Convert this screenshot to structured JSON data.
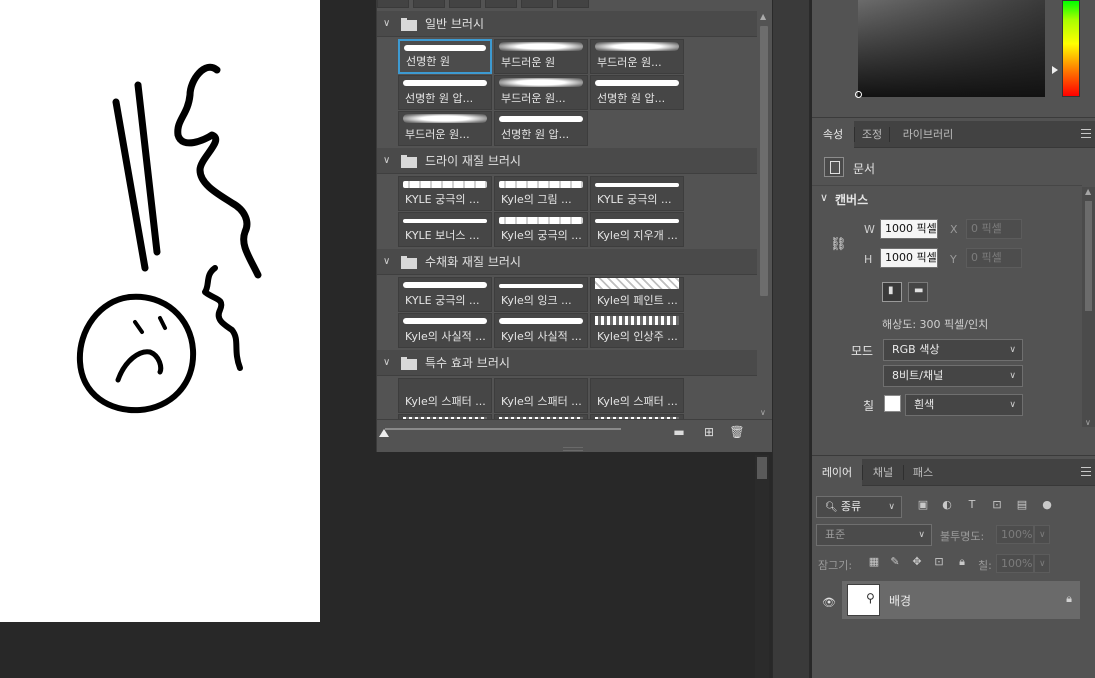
{
  "brush_panel": {
    "groups": [
      {
        "name": "일반 브러시",
        "brushes": [
          "선명한 원",
          "부드러운 원",
          "부드러운 원...",
          "선명한 원 압...",
          "부드러운 원...",
          "선명한 원 압...",
          "부드러운 원...",
          "선명한 원 압..."
        ]
      },
      {
        "name": "드라이 재질 브러시",
        "brushes": [
          "KYLE 궁극의 ...",
          "Kyle의 그림 ...",
          "KYLE 궁극의 ...",
          "KYLE 보너스 ...",
          "Kyle의 궁극의 ...",
          "Kyle의 지우개 ..."
        ]
      },
      {
        "name": "수채화 재질 브러시",
        "brushes": [
          "KYLE 궁극의 ...",
          "Kyle의 잉크 ...",
          "Kyle의 페인트 ...",
          "Kyle의 사실적 ...",
          "Kyle의 사실적 ...",
          "Kyle의 인상주 ..."
        ]
      },
      {
        "name": "특수 효과 브러시",
        "brushes": [
          "Kyle의 스패터 ...",
          "Kyle의 스패터 ...",
          "Kyle의 스패터 ..."
        ]
      }
    ],
    "selected_brush": "선명한 원",
    "footer_icons": [
      "new-group-icon",
      "new-brush-icon",
      "trash-icon"
    ]
  },
  "properties_panel": {
    "tabs": [
      "속성",
      "조정",
      "라이브러리"
    ],
    "active_tab": "속성",
    "doc_label": "문서",
    "section_title": "캔버스",
    "width_label": "W",
    "width_value": "1000 픽셀",
    "height_label": "H",
    "height_value": "1000 픽셀",
    "x_label": "X",
    "x_placeholder": "0 픽셀",
    "y_label": "Y",
    "y_placeholder": "0 픽셀",
    "resolution": "해상도: 300 픽셀/인치",
    "mode_label": "모드",
    "mode_value": "RGB 색상",
    "depth_value": "8비트/채널",
    "fill_label": "칠",
    "fill_value": "흰색"
  },
  "layers_panel": {
    "tabs": [
      "레이어",
      "채널",
      "패스"
    ],
    "active_tab": "레이어",
    "filter_placeholder": "종류",
    "blend_mode": "표준",
    "opacity_label": "불투명도:",
    "opacity_value": "100%",
    "lock_label": "잠그기:",
    "fill_label": "칠:",
    "fill_value": "100%",
    "layers": [
      {
        "name": "배경",
        "visible": true,
        "locked": true
      }
    ]
  },
  "colors": {
    "panel_bg": "#535353",
    "accent": "#3d9ad1",
    "canvas": "#ffffff"
  }
}
